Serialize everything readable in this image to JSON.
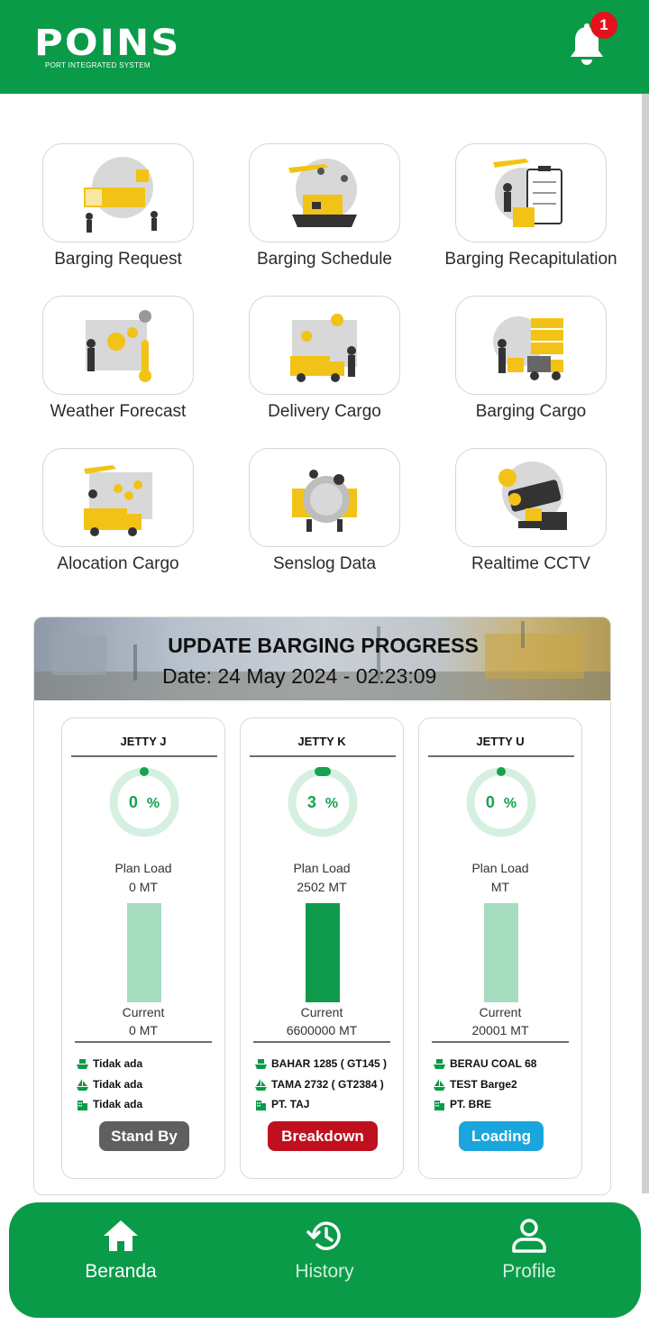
{
  "header": {
    "logo_text": "POINS",
    "logo_subtitle": "PORT INTEGRATED SYSTEM",
    "notification_count": "1"
  },
  "menu": [
    {
      "label": "Barging Request",
      "icon": "barging-request-illustration"
    },
    {
      "label": "Barging Schedule",
      "icon": "barging-schedule-illustration"
    },
    {
      "label": "Barging Recapitulation",
      "icon": "barging-recapitulation-illustration"
    },
    {
      "label": "Weather Forecast",
      "icon": "weather-forecast-illustration"
    },
    {
      "label": "Delivery Cargo",
      "icon": "delivery-cargo-illustration"
    },
    {
      "label": "Barging Cargo",
      "icon": "barging-cargo-illustration"
    },
    {
      "label": "Alocation Cargo",
      "icon": "alocation-cargo-illustration"
    },
    {
      "label": "Senslog Data",
      "icon": "senslog-data-illustration"
    },
    {
      "label": "Realtime CCTV",
      "icon": "realtime-cctv-illustration"
    }
  ],
  "progress": {
    "title": "UPDATE BARGING PROGRESS",
    "date": "Date: 24 May 2024 - 02:23:09",
    "jetties": [
      {
        "name": "JETTY J",
        "percent": "0",
        "percent_symbol": "%",
        "plan_label": "Plan Load",
        "plan_value": "0 MT",
        "bar_level": 0,
        "current_label": "Current",
        "current_value": "0 MT",
        "vessel": "Tidak ada",
        "barge": "Tidak ada",
        "company": "Tidak ada",
        "status": "Stand By",
        "status_color": "#5f5f5f"
      },
      {
        "name": "JETTY K",
        "percent": "3",
        "percent_symbol": "%",
        "plan_label": "Plan Load",
        "plan_value": "2502 MT",
        "bar_level": 1,
        "current_label": "Current",
        "current_value": "6600000 MT",
        "vessel": "BAHAR 1285 ( GT145 )",
        "barge": "TAMA 2732 ( GT2384 )",
        "company": "PT. TAJ",
        "status": "Breakdown",
        "status_color": "#c0101f"
      },
      {
        "name": "JETTY U",
        "percent": "0",
        "percent_symbol": "%",
        "plan_label": "Plan Load",
        "plan_value": "MT",
        "bar_level": 0,
        "current_label": "Current",
        "current_value": "20001 MT",
        "vessel": "BERAU COAL 68",
        "barge": "TEST Barge2",
        "company": "PT. BRE",
        "status": "Loading",
        "status_color": "#1aa6dc"
      }
    ]
  },
  "bottom_nav": [
    {
      "label": "Beranda",
      "icon": "home-icon",
      "active": true
    },
    {
      "label": "History",
      "icon": "history-icon",
      "active": false
    },
    {
      "label": "Profile",
      "icon": "profile-icon",
      "active": false
    }
  ],
  "colors": {
    "brand_green": "#0a9b48",
    "bar_empty": "#a6dcbf",
    "bar_full": "#0f9a4b",
    "ring_track": "#d5f0e0",
    "ring_accent": "#17a24f"
  }
}
